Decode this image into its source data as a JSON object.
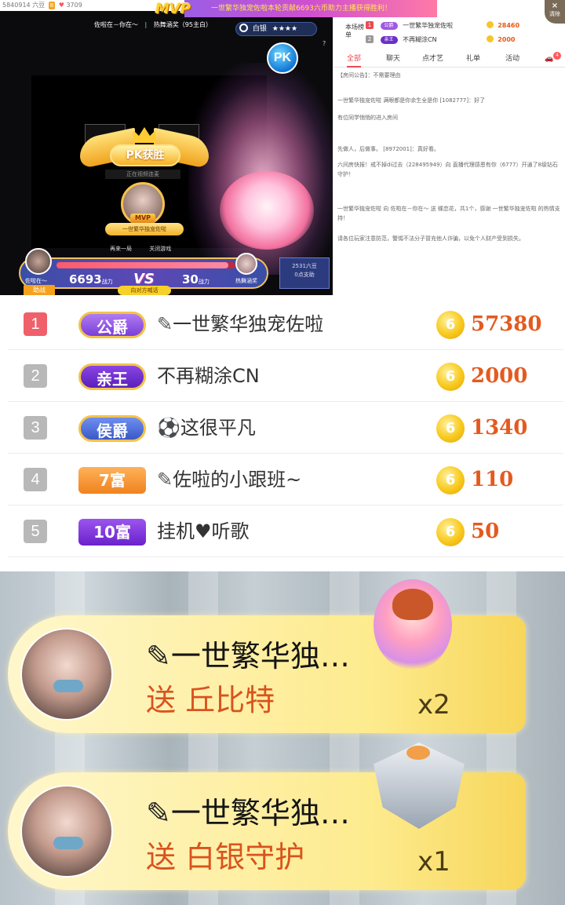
{
  "stream": {
    "topbar": {
      "room_id": "5840914 六豆",
      "level": "8",
      "fans": "3709"
    },
    "pk_left_name": "佐啦在－你在～",
    "pk_right_name": "热舞涵奖（95主白）",
    "rank_label": "白银",
    "rank_stars": "★★★★",
    "help_mark": "?",
    "pk_badge": "PK",
    "win_title": "PK获胜",
    "win_sub": "正在视频连麦",
    "mvp_tag": "MVP",
    "mvp_name": "一世繁华独宠佐啦",
    "replay_label": "再来一局",
    "close_game_label": "关闭游戏",
    "left_score": "6693",
    "right_score": "30",
    "score_unit": "战力",
    "vs_label": "VS",
    "progress_left_share": 0.96,
    "left_anchor_name": "佐啦在～",
    "right_anchor_name": "热舞涵奖",
    "help_label": "助战",
    "chat_button": "向对方喊话",
    "gift_box_line1": "2531六豆",
    "gift_box_line2": "0点支助"
  },
  "banner": {
    "mvp": "MVP",
    "text": "一世繁华独宠佐啦本轮贡献6693六币助力主播获得胜利！"
  },
  "mini_rank": {
    "label": "本场榜单",
    "rows": [
      {
        "rank": "1",
        "badge": "公爵",
        "badge_color": "#a05ae0",
        "name": "一世繁华独宠佐啦",
        "value": "28460",
        "rank_color": "#e94b54"
      },
      {
        "rank": "2",
        "badge": "亲王",
        "badge_color": "#6a2fc8",
        "name": "不再糊涂CN",
        "value": "2000",
        "rank_color": "#999999"
      }
    ],
    "close_label": "清除"
  },
  "tabs": [
    {
      "label": "全部",
      "active": true
    },
    {
      "label": "聊天",
      "active": false
    },
    {
      "label": "点才艺",
      "active": false
    },
    {
      "label": "礼单",
      "active": false
    },
    {
      "label": "活动",
      "active": false
    }
  ],
  "tab_badge": "4",
  "chat": [
    {
      "text": "【房间公告】：不需要理由",
      "color": "#666"
    },
    {
      "text": "一世繁华独宠佐啦 满眼都是你余生全是你 [1082777]：好了",
      "color": "#3a7ad8"
    },
    {
      "text": "有位同学悄悄的进入房间",
      "color": "#666"
    },
    {
      "text": "先做人，后做事。 [8972001]：真好看。",
      "color": "#666"
    },
    {
      "text": "六间房快报！戒不掉di过去（228495949）向 直播代理感恩有你（6777）开通了8级钻石守护！",
      "color": "#e6552b"
    },
    {
      "text": "一世繁华独宠佐啦 向 佐啦在－你在～ 送 蝶恋花，共1个，感谢 一世繁华独宠佐啦 的热情支持！",
      "color": "#3a7ad8"
    },
    {
      "text": "请各位玩家注意防范，警惕不法分子冒充他人诈骗，以免个人财产受到损失。",
      "color": "#e6552b"
    }
  ],
  "leaderboard": [
    {
      "rank": "1",
      "rank_color": "#f0606a",
      "badge": "公爵",
      "badge_color": "#8b4fe0",
      "name": "一世繁华独宠佐啦",
      "coin": "6",
      "value": "57380"
    },
    {
      "rank": "2",
      "rank_color": "#b8b8b8",
      "badge": "亲王",
      "badge_color": "#6a28c8",
      "name": "不再糊涂CN",
      "coin": "6",
      "value": "2000"
    },
    {
      "rank": "3",
      "rank_color": "#b8b8b8",
      "badge": "侯爵",
      "badge_color": "#4a6ee0",
      "name": "⚽这很平凡",
      "coin": "6",
      "value": "1340"
    },
    {
      "rank": "4",
      "rank_color": "#b8b8b8",
      "badge": "7富",
      "badge_color": "#f59a3a",
      "name": "佐啦的小跟班~",
      "coin": "6",
      "value": "110"
    },
    {
      "rank": "5",
      "rank_color": "#b8b8b8",
      "badge": "10富",
      "badge_color": "#7a33d8",
      "name": "挂机♥听歌",
      "coin": "6",
      "value": "50"
    }
  ],
  "gift_notices": [
    {
      "name": "一世繁华独…",
      "action": "送 丘比特",
      "count": "x2"
    },
    {
      "name": "一世繁华独…",
      "action": "送 白银守护",
      "count": "x1"
    }
  ]
}
